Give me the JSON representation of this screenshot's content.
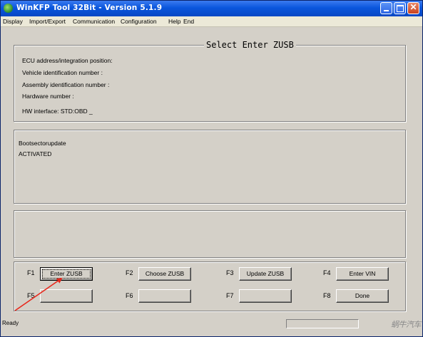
{
  "window": {
    "title": "WinKFP Tool 32Bit - Version 5.1.9"
  },
  "menu": [
    "Display",
    "Import/Export",
    "Communication",
    "Configuration",
    "Help",
    "End"
  ],
  "info_panel": {
    "title": "Select Enter ZUSB",
    "fields": [
      "ECU address/integration position:",
      "Vehicle identification number :",
      "Assembly identification number :",
      "Hardware number :"
    ],
    "hw_interface": "HW interface:  STD:OBD _"
  },
  "log_panel": {
    "lines": [
      "Bootsectorupdate",
      "ACTIVATED"
    ]
  },
  "function_keys": [
    {
      "key": "F1",
      "label": "Enter ZUSB"
    },
    {
      "key": "F2",
      "label": "Choose ZUSB"
    },
    {
      "key": "F3",
      "label": "Update ZUSB"
    },
    {
      "key": "F4",
      "label": "Enter VIN"
    },
    {
      "key": "F5",
      "label": ""
    },
    {
      "key": "F6",
      "label": ""
    },
    {
      "key": "F7",
      "label": ""
    },
    {
      "key": "F8",
      "label": "Done"
    }
  ],
  "status": {
    "text": "Ready",
    "watermark": "蜗牛汽车"
  },
  "colors": {
    "titlebar": "#0a56dc",
    "face": "#d4d0c8",
    "arrow": "#e8271b"
  }
}
